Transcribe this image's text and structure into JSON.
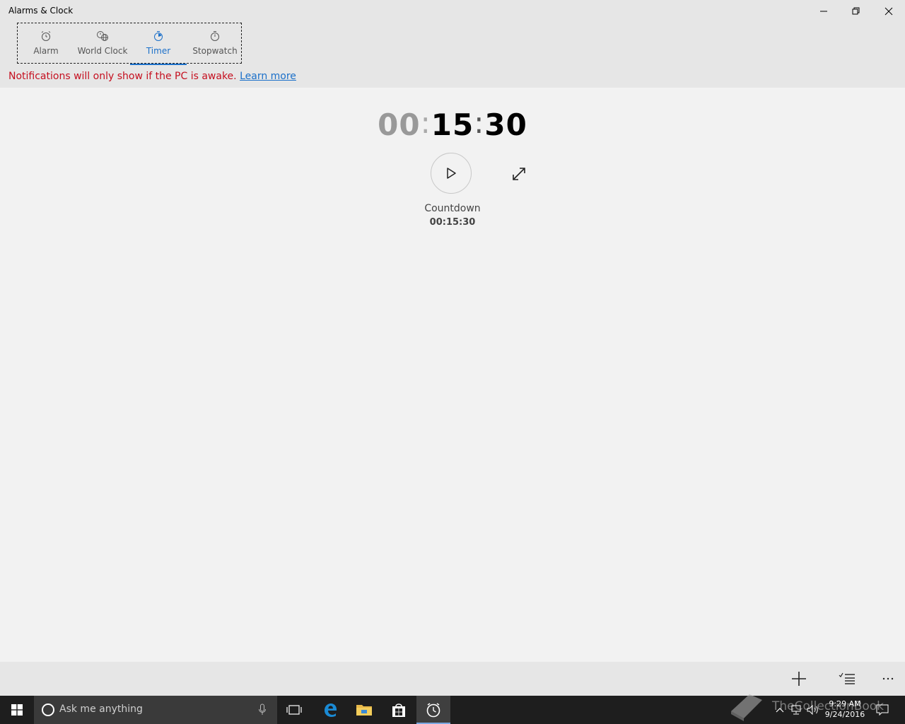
{
  "window": {
    "title": "Alarms & Clock"
  },
  "tabs": [
    {
      "label": "Alarm",
      "icon": "alarm-icon"
    },
    {
      "label": "World Clock",
      "icon": "world-clock-icon"
    },
    {
      "label": "Timer",
      "icon": "timer-icon",
      "active": true
    },
    {
      "label": "Stopwatch",
      "icon": "stopwatch-icon"
    }
  ],
  "notice": {
    "text": "Notifications will only show if the PC is awake.",
    "link": "Learn more"
  },
  "timer": {
    "hours": "00",
    "minutes": "15",
    "seconds": "30",
    "name": "Countdown",
    "small_hours": "00",
    "small_minutes": "15",
    "small_seconds": "30"
  },
  "taskbar": {
    "search_placeholder": "Ask me anything",
    "time": "9:29 AM",
    "date": "9/24/2016",
    "watermark": "TheCollectionBook"
  },
  "colors": {
    "accent": "#1a6fc9",
    "warning": "#c50f1f",
    "taskbar": "#1e1e1e"
  }
}
